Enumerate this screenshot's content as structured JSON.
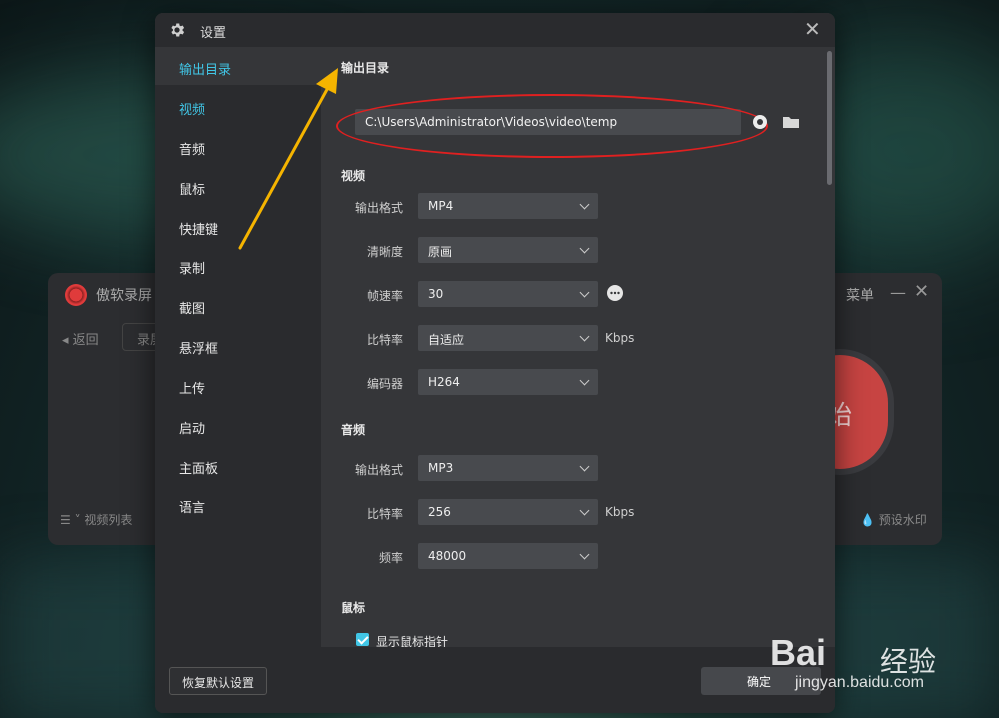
{
  "background_app": {
    "title": "傲软录屏",
    "back_label": "返回",
    "tab_label": "录屏",
    "menu_label": "菜单",
    "start_label": "始",
    "video_list_label": "视频列表",
    "watermark_label": "预设水印"
  },
  "dialog": {
    "title": "设置",
    "icons": {
      "title": "gear-icon",
      "close": "close-icon"
    }
  },
  "sidebar": {
    "items": [
      {
        "label": "输出目录"
      },
      {
        "label": "视频"
      },
      {
        "label": "音频"
      },
      {
        "label": "鼠标"
      },
      {
        "label": "快捷键"
      },
      {
        "label": "录制"
      },
      {
        "label": "截图"
      },
      {
        "label": "悬浮框"
      },
      {
        "label": "上传"
      },
      {
        "label": "启动"
      },
      {
        "label": "主面板"
      },
      {
        "label": "语言"
      }
    ],
    "active_index": 0
  },
  "output": {
    "section_title": "输出目录",
    "path": "C:\\Users\\Administrator\\Videos\\video\\temp"
  },
  "video": {
    "section_title": "视频",
    "fields": [
      {
        "label": "输出格式",
        "value": "MP4"
      },
      {
        "label": "清晰度",
        "value": "原画"
      },
      {
        "label": "帧速率",
        "value": "30"
      },
      {
        "label": "比特率",
        "value": "自适应",
        "unit": "Kbps"
      },
      {
        "label": "编码器",
        "value": "H264"
      }
    ]
  },
  "audio": {
    "section_title": "音频",
    "fields": [
      {
        "label": "输出格式",
        "value": "MP3"
      },
      {
        "label": "比特率",
        "value": "256",
        "unit": "Kbps"
      },
      {
        "label": "频率",
        "value": "48000"
      }
    ]
  },
  "mouse": {
    "section_title": "鼠标",
    "show_pointer_label": "显示鼠标指针",
    "show_pointer_checked": true
  },
  "footer": {
    "reset_label": "恢复默认设置",
    "ok_label": "确定"
  },
  "watermark": {
    "brand": "Bai",
    "brand_suffix": "经验",
    "url": "jingyan.baidu.com"
  },
  "colors": {
    "accent": "#41c6e6",
    "annotation_ellipse": "#e02020",
    "annotation_arrow": "#f5b400"
  }
}
